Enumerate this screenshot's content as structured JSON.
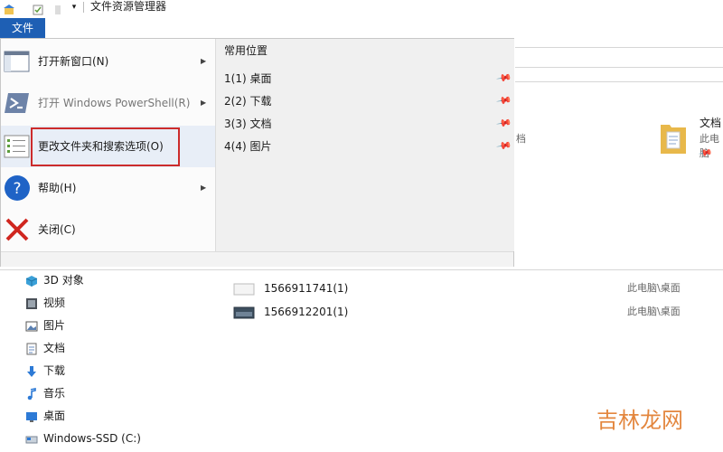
{
  "window": {
    "title": "文件资源管理器"
  },
  "ribbon": {
    "file_tab": "文件"
  },
  "file_menu": {
    "items": [
      {
        "label": "打开新窗口(N)",
        "has_submenu": true,
        "dimmed": false,
        "icon": "new-window-icon"
      },
      {
        "label": "打开 Windows PowerShell(R)",
        "has_submenu": true,
        "dimmed": true,
        "icon": "powershell-icon"
      },
      {
        "label": "更改文件夹和搜索选项(O)",
        "has_submenu": false,
        "dimmed": false,
        "icon": "options-icon",
        "highlighted": true
      },
      {
        "label": "帮助(H)",
        "has_submenu": true,
        "dimmed": false,
        "icon": "help-icon"
      },
      {
        "label": "关闭(C)",
        "has_submenu": false,
        "dimmed": false,
        "icon": "close-icon"
      }
    ],
    "recent_title": "常用位置",
    "recent_items": [
      {
        "label": "1(1)  桌面"
      },
      {
        "label": "2(2)  下载"
      },
      {
        "label": "3(3)  文档"
      },
      {
        "label": "4(4)  图片"
      }
    ]
  },
  "folders_view": {
    "partial_text": "档",
    "tile": {
      "name": "文档",
      "sub": "此电脑"
    }
  },
  "nav_pane": {
    "items": [
      {
        "label": "3D 对象",
        "icon": "3d-objects-icon"
      },
      {
        "label": "视频",
        "icon": "videos-icon"
      },
      {
        "label": "图片",
        "icon": "pictures-icon"
      },
      {
        "label": "文档",
        "icon": "documents-icon"
      },
      {
        "label": "下载",
        "icon": "downloads-icon"
      },
      {
        "label": "音乐",
        "icon": "music-icon"
      },
      {
        "label": "桌面",
        "icon": "desktop-icon"
      },
      {
        "label": "Windows-SSD (C:)",
        "icon": "drive-icon"
      }
    ]
  },
  "recent_files": [
    {
      "name": "1566911741(1)",
      "location": "此电脑\\桌面"
    },
    {
      "name": "1566912201(1)",
      "location": "此电脑\\桌面"
    }
  ],
  "watermark": "吉林龙网",
  "colors": {
    "accent": "#1e5fb4",
    "highlight_border": "#cc2b2b",
    "folder": "#e8b84a"
  }
}
